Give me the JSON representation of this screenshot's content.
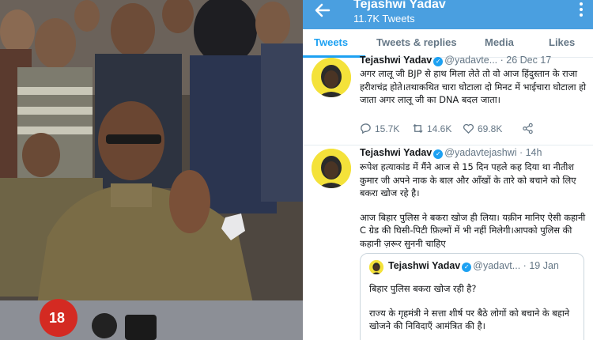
{
  "header": {
    "title": "Tejashwi Yadav",
    "tweet_count": "11.7K Tweets",
    "bg_color": "#4a9fe0"
  },
  "tabs": [
    {
      "label": "Tweets",
      "active": true
    },
    {
      "label": "Tweets & replies",
      "active": false
    },
    {
      "label": "Media",
      "active": false
    },
    {
      "label": "Likes",
      "active": false
    }
  ],
  "accent_color": "#1da1f2",
  "tweets": [
    {
      "name": "Tejashwi Yadav",
      "handle": "@yadavte...",
      "time": "26 Dec 17",
      "text": "अगर लालू जी BJP से हाथ मिला लेते तो वो आज हिंदुस्तान के राजा हरीशचंद्र होते।तथाकथित चारा घोटाला दो मिनट में भाईचारा घोटाला हो जाता अगर लालू जी का DNA बदल जाता।",
      "replies": "15.7K",
      "retweets": "14.6K",
      "likes": "69.8K"
    },
    {
      "name": "Tejashwi Yadav",
      "handle": "@yadavtejashwi",
      "time": "14h",
      "paragraphs": [
        "रूपेश हत्याकांड में मैंने आज से 15 दिन पहले कह दिया था नीतीश कुमार जी अपने नाक के बाल और आँखों के तारे को बचाने को लिए बकरा खोज रहे है।",
        "आज बिहार पुलिस ने बकरा खोज ही लिया। यक़ीन मानिए ऐसी कहानी C ग्रेड की घिसी-पिटी फ़िल्मों में भी नहीं मिलेगी।आपको पुलिस की कहानी ज़रूर सुननी चाहिए"
      ],
      "quoted": {
        "name": "Tejashwi Yadav",
        "handle": "@yadavt...",
        "time": "19 Jan",
        "paragraphs": [
          "बिहार पुलिस बकरा खोज रही है?",
          "राज्य के गृहमंत्री ने सत्ता शीर्ष पर बैठे लोगों को बचाने के बहाने खोजने की निविदाएँ आमंत्रित की है।"
        ]
      }
    }
  ],
  "photo": {
    "microphone_logo": "18"
  }
}
